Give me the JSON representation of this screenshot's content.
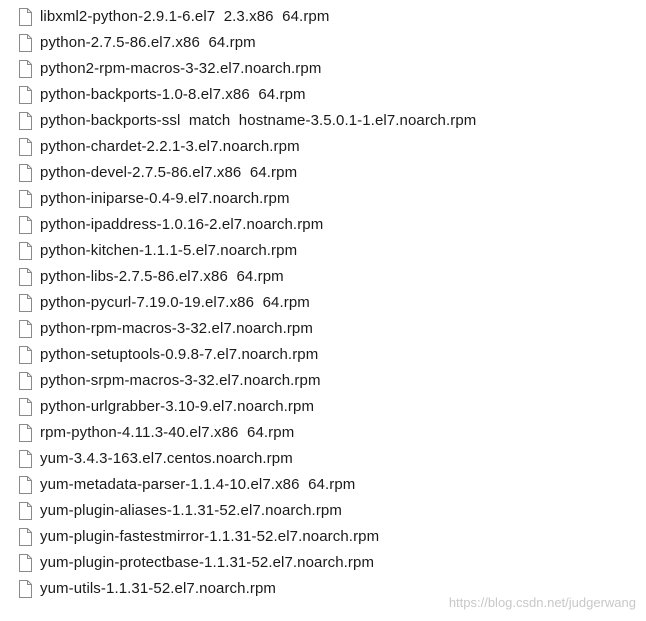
{
  "files": [
    {
      "name": "libxml2-python-2.9.1-6.el7  2.3.x86  64.rpm",
      "icon": "document-icon"
    },
    {
      "name": "python-2.7.5-86.el7.x86  64.rpm",
      "icon": "document-icon"
    },
    {
      "name": "python2-rpm-macros-3-32.el7.noarch.rpm",
      "icon": "document-icon"
    },
    {
      "name": "python-backports-1.0-8.el7.x86  64.rpm",
      "icon": "document-icon"
    },
    {
      "name": "python-backports-ssl  match  hostname-3.5.0.1-1.el7.noarch.rpm",
      "icon": "document-icon"
    },
    {
      "name": "python-chardet-2.2.1-3.el7.noarch.rpm",
      "icon": "document-icon"
    },
    {
      "name": "python-devel-2.7.5-86.el7.x86  64.rpm",
      "icon": "document-icon"
    },
    {
      "name": "python-iniparse-0.4-9.el7.noarch.rpm",
      "icon": "document-icon"
    },
    {
      "name": "python-ipaddress-1.0.16-2.el7.noarch.rpm",
      "icon": "document-icon"
    },
    {
      "name": "python-kitchen-1.1.1-5.el7.noarch.rpm",
      "icon": "document-icon"
    },
    {
      "name": "python-libs-2.7.5-86.el7.x86  64.rpm",
      "icon": "document-icon"
    },
    {
      "name": "python-pycurl-7.19.0-19.el7.x86  64.rpm",
      "icon": "document-icon"
    },
    {
      "name": "python-rpm-macros-3-32.el7.noarch.rpm",
      "icon": "document-icon"
    },
    {
      "name": "python-setuptools-0.9.8-7.el7.noarch.rpm",
      "icon": "document-icon"
    },
    {
      "name": "python-srpm-macros-3-32.el7.noarch.rpm",
      "icon": "document-icon"
    },
    {
      "name": "python-urlgrabber-3.10-9.el7.noarch.rpm",
      "icon": "document-icon"
    },
    {
      "name": "rpm-python-4.11.3-40.el7.x86  64.rpm",
      "icon": "document-icon"
    },
    {
      "name": "yum-3.4.3-163.el7.centos.noarch.rpm",
      "icon": "document-icon"
    },
    {
      "name": "yum-metadata-parser-1.1.4-10.el7.x86  64.rpm",
      "icon": "document-icon"
    },
    {
      "name": "yum-plugin-aliases-1.1.31-52.el7.noarch.rpm",
      "icon": "document-icon"
    },
    {
      "name": "yum-plugin-fastestmirror-1.1.31-52.el7.noarch.rpm",
      "icon": "document-icon"
    },
    {
      "name": "yum-plugin-protectbase-1.1.31-52.el7.noarch.rpm",
      "icon": "document-icon"
    },
    {
      "name": "yum-utils-1.1.31-52.el7.noarch.rpm",
      "icon": "document-icon"
    }
  ],
  "watermark": "https://blog.csdn.net/judgerwang",
  "colors": {
    "text": "#1a1a1a",
    "icon_stroke": "#8a8a8a",
    "watermark": "#c8c8c8"
  }
}
